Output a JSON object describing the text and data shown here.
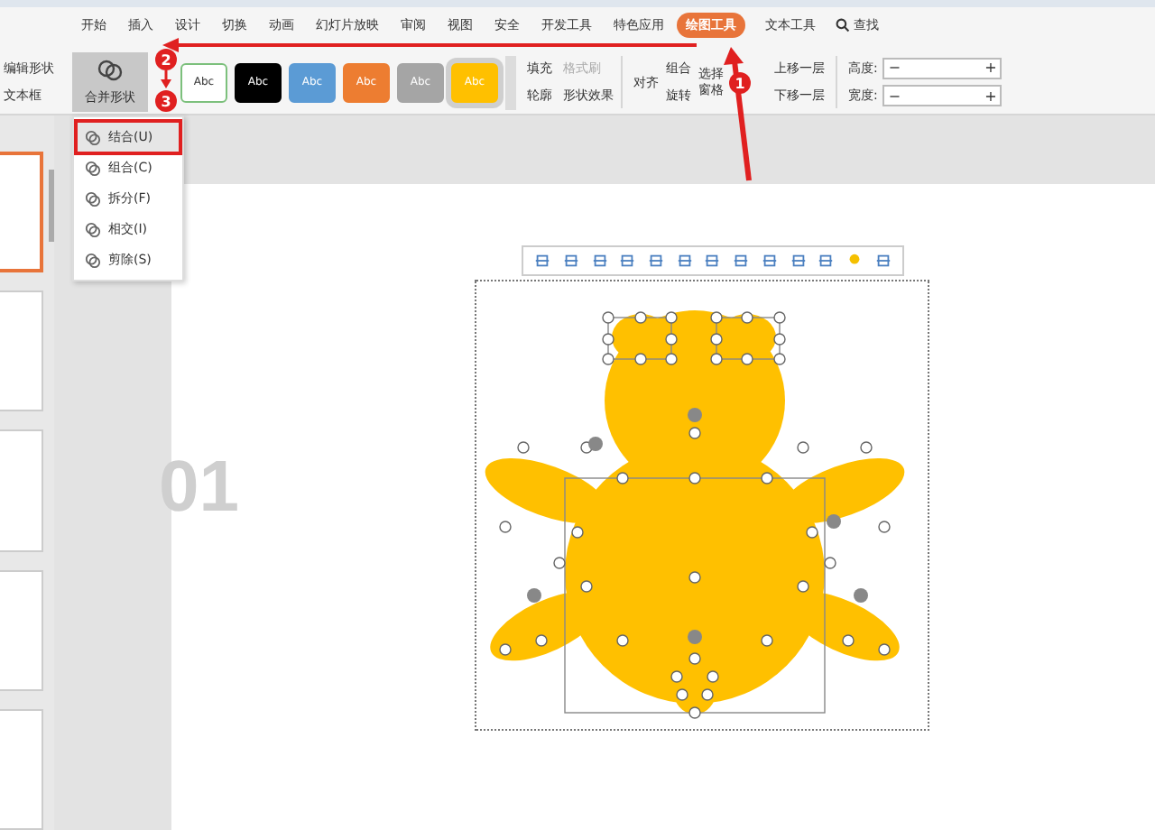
{
  "tabs": [
    {
      "label": "开始",
      "selected": false
    },
    {
      "label": "插入",
      "selected": false
    },
    {
      "label": "设计",
      "selected": false
    },
    {
      "label": "切换",
      "selected": false
    },
    {
      "label": "动画",
      "selected": false
    },
    {
      "label": "幻灯片放映",
      "selected": false
    },
    {
      "label": "审阅",
      "selected": false
    },
    {
      "label": "视图",
      "selected": false
    },
    {
      "label": "安全",
      "selected": false
    },
    {
      "label": "开发工具",
      "selected": false
    },
    {
      "label": "特色应用",
      "selected": false
    },
    {
      "label": "绘图工具",
      "selected": true
    },
    {
      "label": "文本工具",
      "selected": false
    }
  ],
  "search": "查找",
  "left_group": [
    "编辑形状",
    "文本框"
  ],
  "merge_button": "合并形状",
  "style_swatches": [
    {
      "label": "Abc",
      "color": "#ffffff",
      "selected": false
    },
    {
      "label": "Abc",
      "color": "#000000",
      "selected": false
    },
    {
      "label": "Abc",
      "color": "#5b9bd5",
      "selected": false
    },
    {
      "label": "Abc",
      "color": "#ed7d31",
      "selected": false
    },
    {
      "label": "Abc",
      "color": "#a5a5a5",
      "selected": false
    },
    {
      "label": "Abc",
      "color": "#ffc000",
      "selected": true
    }
  ],
  "format_tools": [
    {
      "label": "填充",
      "disabled": false
    },
    {
      "label": "格式刷",
      "disabled": true
    },
    {
      "label": "轮廓",
      "disabled": false
    },
    {
      "label": "形状效果",
      "disabled": false
    }
  ],
  "arrange_tools": {
    "align": "对齐",
    "group": "组合",
    "rotate": "旋转",
    "selection_pane": "选择窗格",
    "bring_forward": "上移一层",
    "send_backward": "下移一层"
  },
  "size_fields": [
    {
      "label": "高度:",
      "decrement": "−",
      "increment": "+"
    },
    {
      "label": "宽度:",
      "decrement": "−",
      "increment": "+"
    }
  ],
  "merge_menu": [
    {
      "label": "结合(U)",
      "selected": true
    },
    {
      "label": "组合(C)",
      "selected": false
    },
    {
      "label": "拆分(F)",
      "selected": false
    },
    {
      "label": "相交(I)",
      "selected": false
    },
    {
      "label": "剪除(S)",
      "selected": false
    }
  ],
  "slides": [
    {
      "selected": true
    },
    {
      "selected": false
    },
    {
      "selected": false
    },
    {
      "selected": false
    },
    {
      "selected": false
    }
  ],
  "slide_number_text": "01",
  "annotations": [
    {
      "label": "1"
    },
    {
      "label": "2"
    },
    {
      "label": "3"
    }
  ]
}
